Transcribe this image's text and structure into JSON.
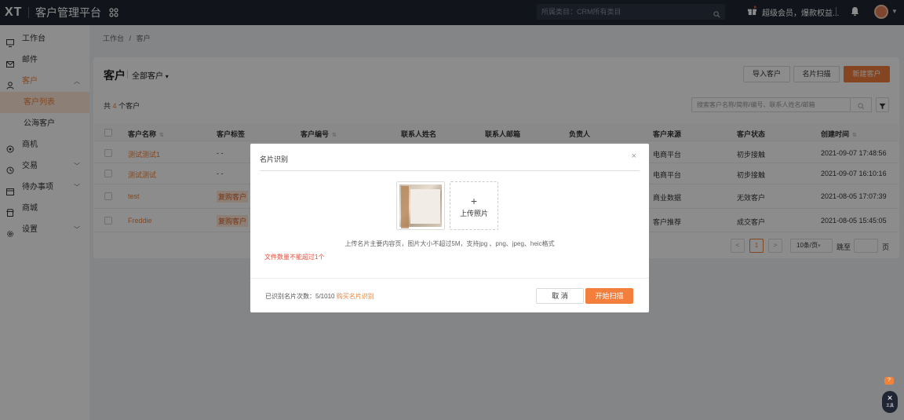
{
  "topbar": {
    "logo": "XT",
    "title": "客户管理平台",
    "scope_label": "所属类目：CRM所有类目",
    "vip_text": "超级会员，爆款权益..."
  },
  "sidebar": {
    "items": [
      {
        "label": "工作台",
        "icon": "desktop-icon"
      },
      {
        "label": "邮件",
        "icon": "mail-icon"
      },
      {
        "label": "客户",
        "icon": "user-icon"
      },
      {
        "label": "商机",
        "icon": "opportunity-icon"
      },
      {
        "label": "交易",
        "icon": "clock-icon"
      },
      {
        "label": "待办事项",
        "icon": "calendar-icon"
      },
      {
        "label": "商城",
        "icon": "shop-icon"
      },
      {
        "label": "设置",
        "icon": "gear-icon"
      }
    ],
    "sub_items": [
      "客户列表",
      "公海客户"
    ]
  },
  "breadcrumb": {
    "root": "工作台",
    "sep": "/",
    "current": "客户"
  },
  "page": {
    "title": "客户",
    "view": "全部客户",
    "import_btn": "导入客户",
    "scan_btn": "名片扫描",
    "new_btn": "新建客户",
    "count_prefix": "共",
    "count": "4",
    "count_suffix": "个客户",
    "search_placeholder": "搜索客户名称/简称/编号、联系人姓名/邮箱"
  },
  "table": {
    "headers": [
      "客户名称",
      "客户标签",
      "客户编号",
      "联系人姓名",
      "联系人邮箱",
      "负责人",
      "客户来源",
      "客户状态",
      "创建时间"
    ],
    "rows": [
      {
        "name": "测试测试1",
        "tag": "- -",
        "source": "电商平台",
        "status": "初步接触",
        "created": "2021-09-07 17:48:56"
      },
      {
        "name": "测试测试",
        "tag": "- -",
        "source": "电商平台",
        "status": "初步接触",
        "created": "2021-09-07 16:10:16"
      },
      {
        "name": "test",
        "tag": "复购客户",
        "source": "商业数据",
        "status": "无效客户",
        "created": "2021-08-05 17:07:39"
      },
      {
        "name": "Freddie",
        "tag": "复购客户",
        "source": "客户推荐",
        "status": "成交客户",
        "created": "2021-08-05 15:45:05"
      }
    ]
  },
  "pager": {
    "prev": "<",
    "current": "1",
    "next": ">",
    "size": "10条/页",
    "jump": "跳至",
    "unit": "页"
  },
  "modal": {
    "title": "名片识别",
    "close": "×",
    "upload_label": "上传照片",
    "upload_plus": "+",
    "hint": "上传名片主要内容页，图片大小不超过5M，支持jpg 、png、jpeg、heic格式",
    "error": "文件数量不能超过1个",
    "usage_label": "已识别名片次数：",
    "usage_value": "5/1010",
    "buy_link": "购买名片识别",
    "cancel": "取 消",
    "start": "开始扫描"
  },
  "fab": {
    "label": "工具",
    "badge": "?"
  },
  "colors": {
    "accent": "#f47e3c",
    "topbar": "#1f2532"
  }
}
